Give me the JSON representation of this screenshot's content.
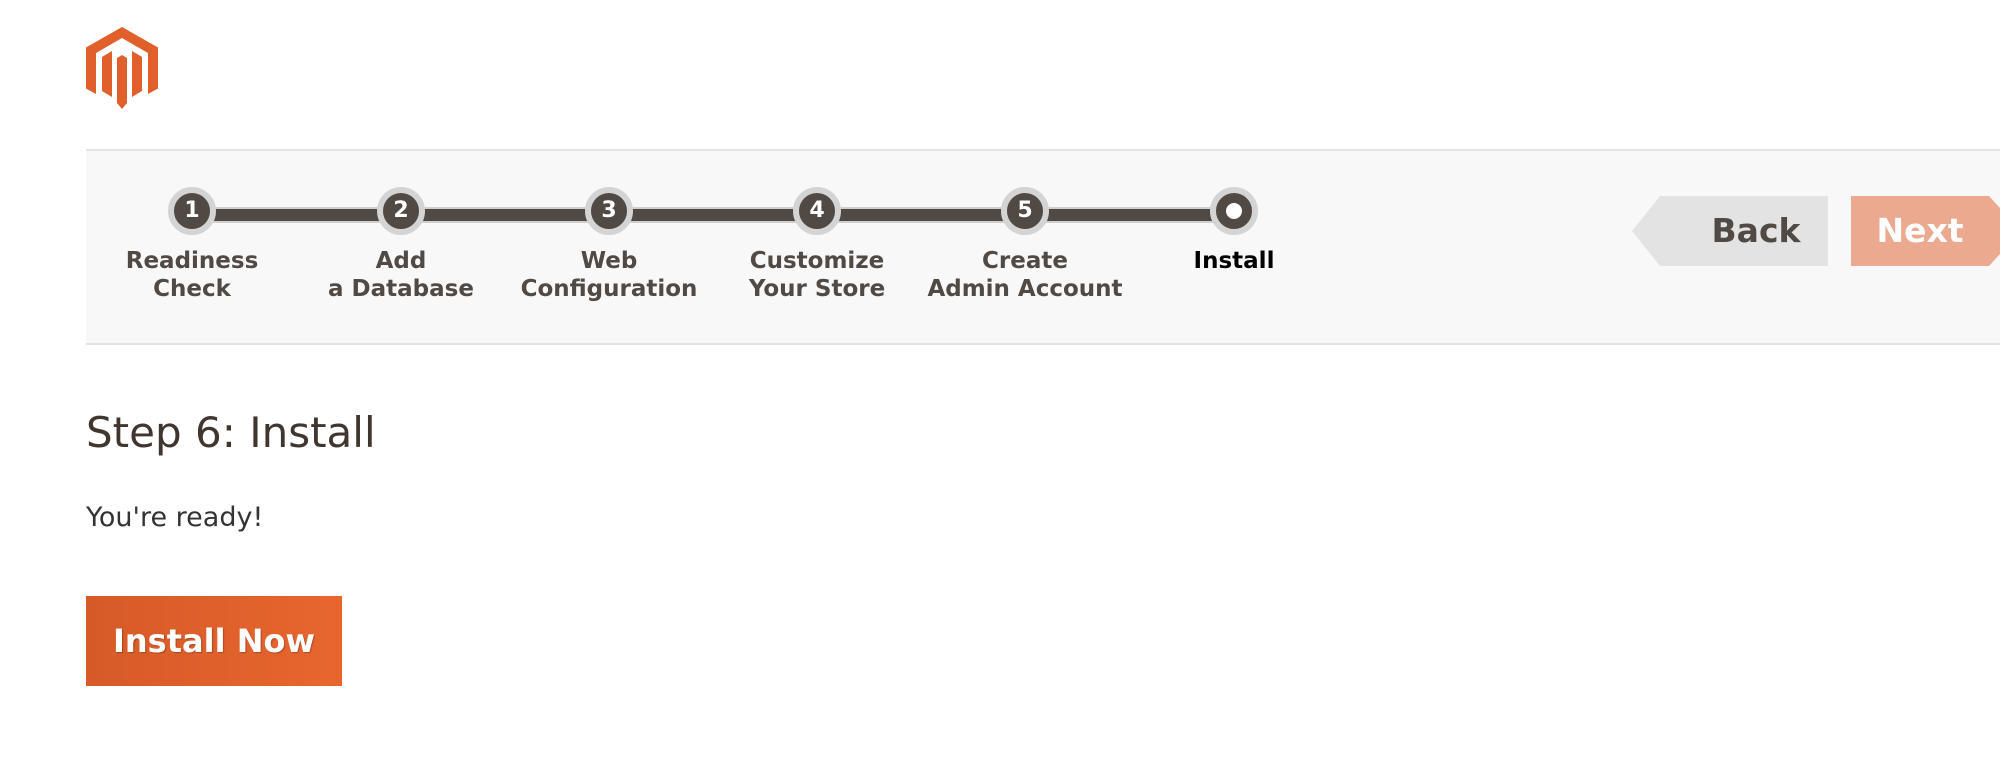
{
  "brand": {
    "logo_icon": "magento-logo-icon",
    "accent_color": "#eb5202"
  },
  "progress": {
    "current_step": 6,
    "total_steps": 6,
    "steps": [
      {
        "number": "1",
        "label": "Readiness\nCheck"
      },
      {
        "number": "2",
        "label": "Add\na Database"
      },
      {
        "number": "3",
        "label": "Web\nConfiguration"
      },
      {
        "number": "4",
        "label": "Customize\nYour Store"
      },
      {
        "number": "5",
        "label": "Create\nAdmin Account"
      },
      {
        "number": "",
        "label": "Install"
      }
    ]
  },
  "nav": {
    "back_label": "Back",
    "next_label": "Next"
  },
  "main": {
    "title": "Step 6: Install",
    "ready_text": "You're ready!",
    "install_button": "Install Now"
  }
}
